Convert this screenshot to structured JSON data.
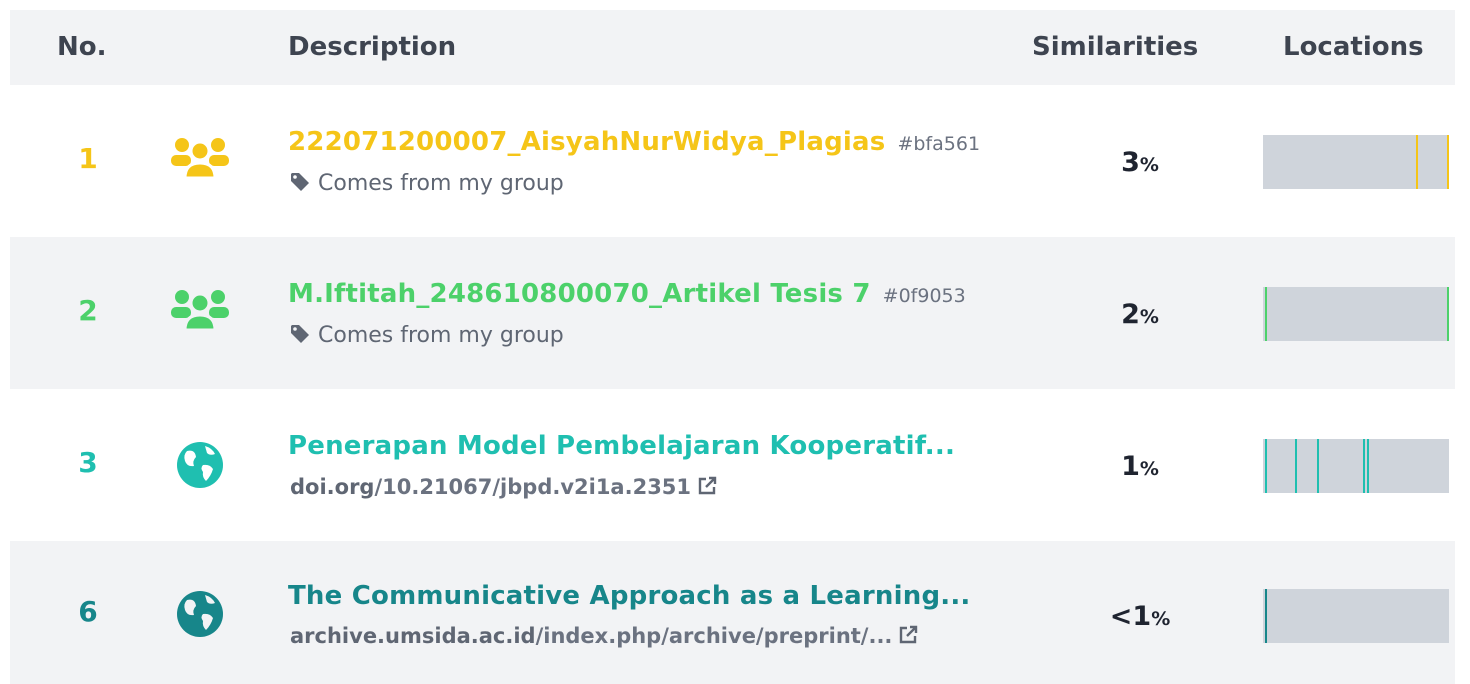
{
  "header": {
    "no": "No.",
    "description": "Description",
    "similarities": "Similarities",
    "locations": "Locations"
  },
  "rows": [
    {
      "no": "1",
      "color": "#f5c518",
      "icon": "group-icon",
      "title": "222071200007_AisyahNurWidya_Plagias",
      "hash": "#bfa561",
      "subtitle": "Comes from my group",
      "similarity": "3",
      "percent_sign": "%",
      "location_marks": [
        0.82,
        0.99
      ]
    },
    {
      "no": "2",
      "color": "#4cd16a",
      "icon": "group-icon",
      "title": "M.Iftitah_248610800070_Artikel Tesis 7",
      "hash": "#0f9053",
      "subtitle": "Comes from my group",
      "similarity": "2",
      "percent_sign": "%",
      "location_marks": [
        0.01,
        0.99
      ]
    },
    {
      "no": "3",
      "color": "#1fbfb0",
      "icon": "globe-icon",
      "title": "Penerapan Model Pembelajaran Kooperatif...",
      "url_domain": "doi.org",
      "url_path": "/10.21067/jbpd.v2i1a.2351",
      "similarity": "1",
      "percent_sign": "%",
      "location_marks": [
        0.01,
        0.17,
        0.29,
        0.54,
        0.56
      ]
    },
    {
      "no": "6",
      "color": "#17868a",
      "icon": "globe-icon",
      "title": "The Communicative Approach as a Learning...",
      "url_domain": "archive.umsida.ac.id",
      "url_path": "/index.php/archive/preprint/...",
      "similarity": "<1",
      "percent_sign": "%",
      "location_marks": [
        0.01
      ]
    }
  ],
  "colors": {
    "header_bg": "#f2f3f5",
    "location_bar": "#cfd4db",
    "text_dark": "#1f2430",
    "text_muted": "#5f6673"
  }
}
